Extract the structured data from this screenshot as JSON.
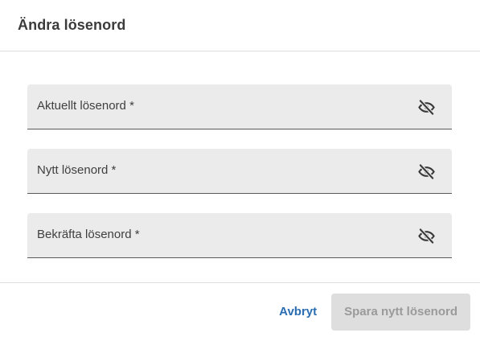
{
  "dialog": {
    "title": "Ändra lösenord"
  },
  "fields": [
    {
      "label": "Aktuellt lösenord *",
      "value": "",
      "visibility_icon": "eye-off-icon"
    },
    {
      "label": "Nytt lösenord *",
      "value": "",
      "visibility_icon": "eye-off-icon"
    },
    {
      "label": "Bekräfta lösenord *",
      "value": "",
      "visibility_icon": "eye-off-icon"
    }
  ],
  "footer": {
    "cancel_label": "Avbryt",
    "save_label": "Spara nytt lösenord",
    "save_disabled": true
  },
  "colors": {
    "accent": "#2a6db2",
    "field_background": "#ebebeb",
    "disabled_button_background": "#dedede",
    "disabled_button_text": "#9a9a9a"
  }
}
